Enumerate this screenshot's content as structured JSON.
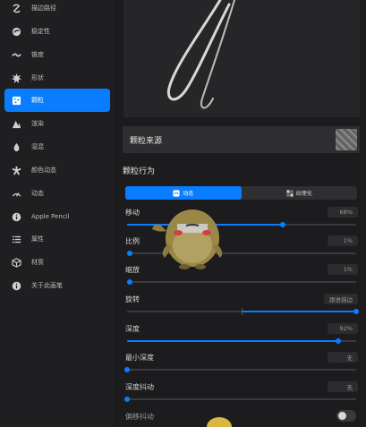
{
  "sidebar": {
    "items": [
      {
        "label": "描边路径",
        "icon": "stroke-path-icon",
        "active": false
      },
      {
        "label": "稳定性",
        "icon": "stabilization-icon",
        "active": false
      },
      {
        "label": "锥度",
        "icon": "taper-icon",
        "active": false
      },
      {
        "label": "形状",
        "icon": "shape-icon",
        "active": false
      },
      {
        "label": "颗粒",
        "icon": "grain-icon",
        "active": true
      },
      {
        "label": "渲染",
        "icon": "rendering-icon",
        "active": false
      },
      {
        "label": "湿混",
        "icon": "wet-mix-icon",
        "active": false
      },
      {
        "label": "颜色动态",
        "icon": "color-dynamics-icon",
        "active": false
      },
      {
        "label": "动态",
        "icon": "dynamics-icon",
        "active": false
      },
      {
        "label": "Apple Pencil",
        "icon": "apple-pencil-icon",
        "active": false
      },
      {
        "label": "属性",
        "icon": "properties-icon",
        "active": false
      },
      {
        "label": "材质",
        "icon": "materials-icon",
        "active": false
      },
      {
        "label": "关于此画笔",
        "icon": "about-brush-icon",
        "active": false
      }
    ]
  },
  "main": {
    "grain_source_label": "颗粒来源",
    "grain_behavior_title": "颗粒行为",
    "segmented": {
      "moving_label": "动态",
      "textured_label": "纹理化",
      "selected": "动态"
    },
    "settings": [
      {
        "key": "move",
        "label": "移动",
        "value": "68%",
        "level": 0.68
      },
      {
        "key": "scale",
        "label": "比例",
        "value": "1%",
        "level": 0.01
      },
      {
        "key": "zoom",
        "label": "缩放",
        "value": "1%",
        "level": 0.01
      },
      {
        "key": "rotation",
        "label": "旋转",
        "value": "跟进描边",
        "level": 1.0
      },
      {
        "key": "depth",
        "label": "深度",
        "value": "92%",
        "level": 0.92
      },
      {
        "key": "min_depth",
        "label": "最小深度",
        "value": "无",
        "level": 0.0
      },
      {
        "key": "depth_jitter",
        "label": "深度抖动",
        "value": "无",
        "level": 0.0
      },
      {
        "key": "offset_jitter",
        "label": "偏移抖动",
        "toggle": false
      }
    ]
  },
  "colors": {
    "accent": "#0a7cff",
    "sidebar_bg": "#1f1f21",
    "main_bg": "#1c1c1e"
  }
}
